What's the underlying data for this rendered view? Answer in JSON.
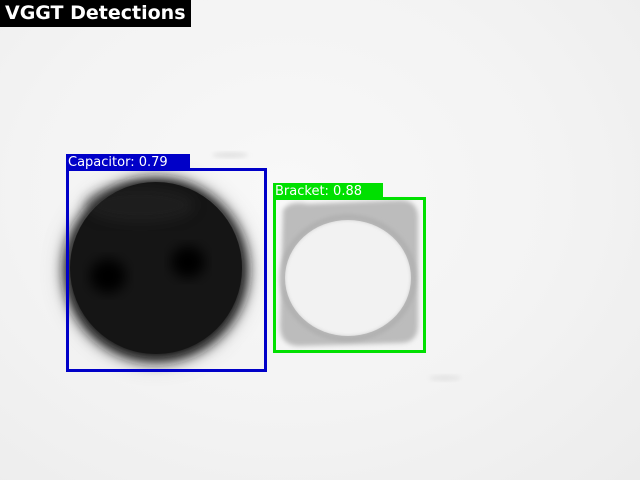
{
  "title": "VGGT Detections",
  "detections": [
    {
      "label": "Capacitor: 0.79",
      "color": "#0000c8"
    },
    {
      "label": "Bracket: 0.88",
      "color": "#00e000"
    }
  ]
}
